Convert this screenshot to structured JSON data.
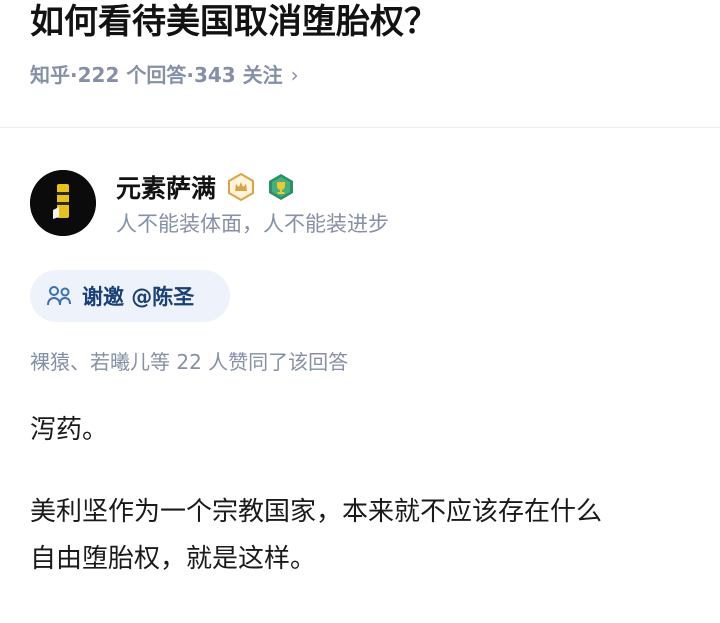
{
  "question": {
    "title": "如何看待美国取消堕胎权？",
    "source": "知乎",
    "answers_count_text": "222 个回答",
    "followers_text": "343 关注",
    "sep": "·",
    "chevron": "›"
  },
  "author": {
    "name": "元素萨满",
    "bio": "人不能装体面，人不能装进步",
    "badges": [
      "crown-badge-icon",
      "trophy-badge-icon"
    ]
  },
  "invite": {
    "label": "谢邀 @陈圣",
    "icon": "people-icon"
  },
  "upvotes": {
    "text": "裸猿、若曦儿等 22 人赞同了该回答"
  },
  "answer": {
    "p1": "泻药。",
    "p2_line1": "美利坚作为一个宗教国家，本来就不应该存在什么",
    "p2_line2": "自由堕胎权，就是这样。"
  },
  "colors": {
    "meta_gray": "#8590a6",
    "invite_bg": "#eef3fb",
    "invite_text": "#1b3f77",
    "badge_gold": "#d9a441",
    "badge_green": "#2e8f63"
  }
}
